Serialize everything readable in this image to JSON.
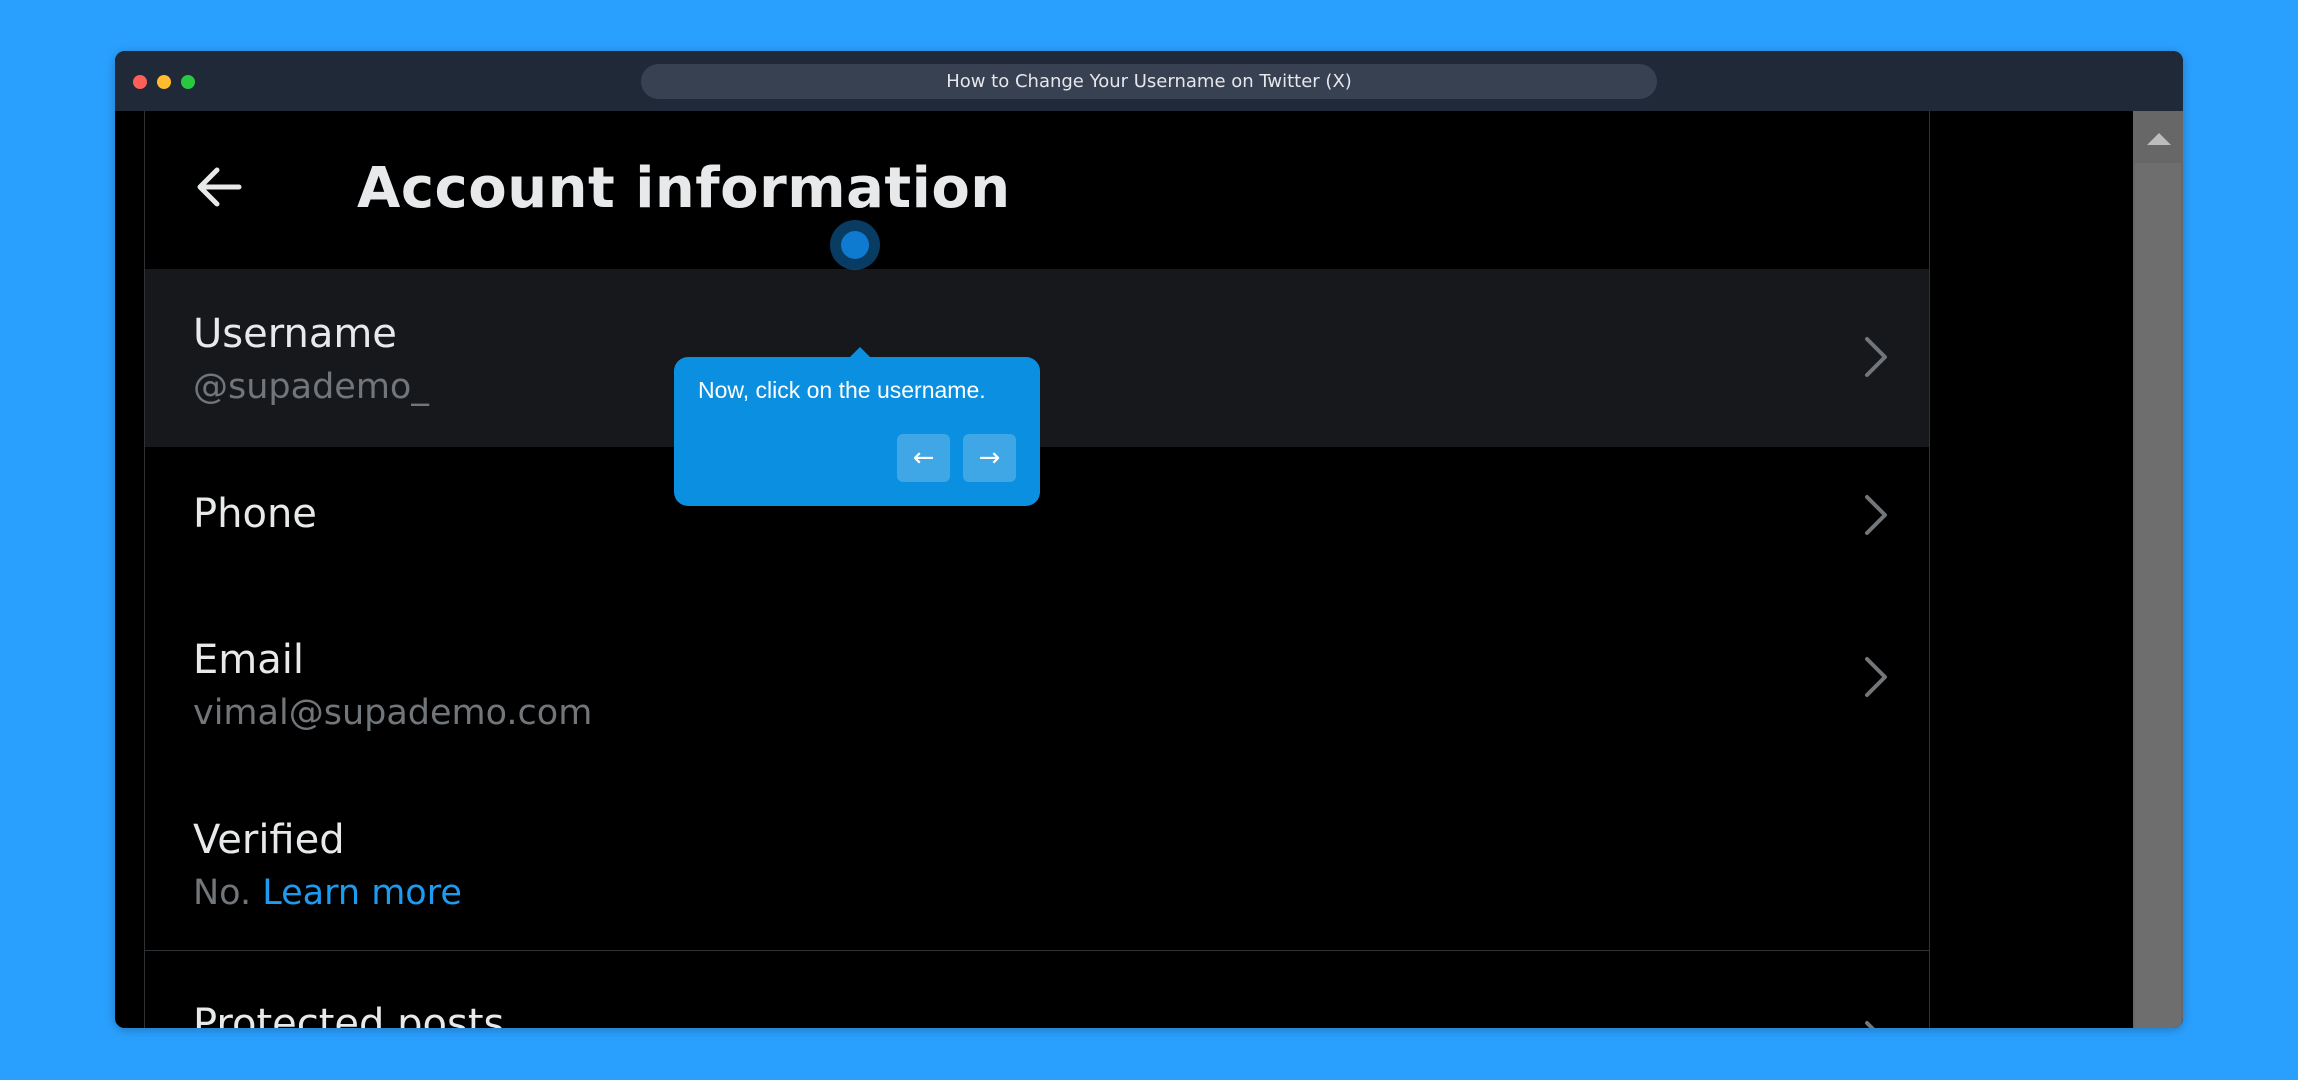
{
  "window": {
    "tab_title": "How to Change Your Username on Twitter (X)"
  },
  "page": {
    "title": "Account information",
    "back_icon": "arrow-left-icon",
    "rows": [
      {
        "label": "Username",
        "value": "@supademo_"
      },
      {
        "label": "Phone"
      },
      {
        "label": "Email",
        "value": "vimal@supademo.com"
      },
      {
        "label": "Verified",
        "value": "No.",
        "link": "Learn more"
      },
      {
        "label": "Protected posts"
      }
    ]
  },
  "tooltip": {
    "text": "Now, click on the username.",
    "prev_label": "←",
    "next_label": "→"
  },
  "colors": {
    "background": "#2aa0fe",
    "tooltip": "#0b8fe0",
    "link": "#1d9bf0"
  }
}
